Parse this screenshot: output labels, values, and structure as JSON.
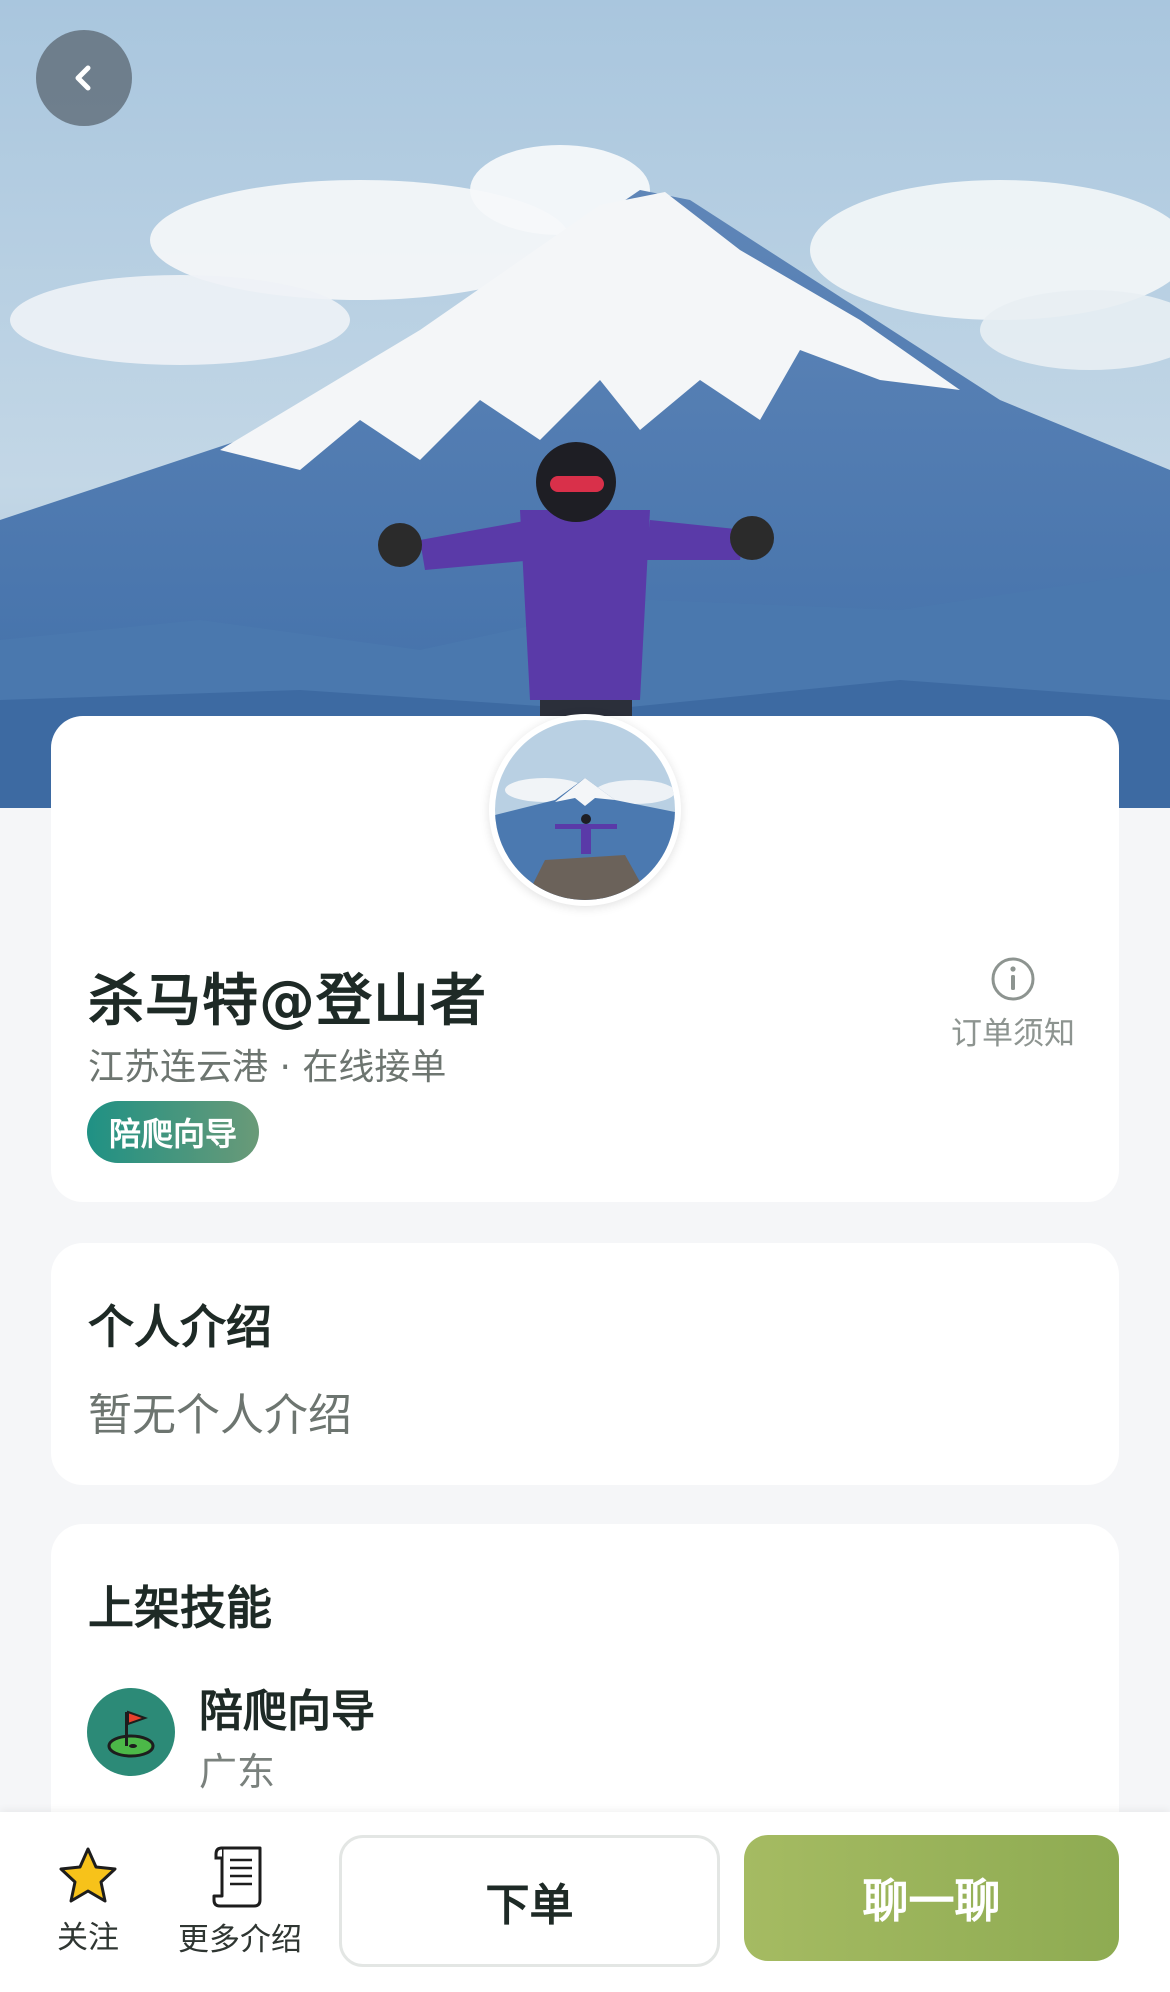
{
  "header": {
    "back_icon": "chevron-left-icon"
  },
  "profile": {
    "name": "杀马特@登山者",
    "location": "江苏连云港 · 在线接单",
    "tag": "陪爬向导",
    "notice_label": "订单须知",
    "notice_icon": "info-icon"
  },
  "intro": {
    "title": "个人介绍",
    "text": "暂无个人介绍"
  },
  "skills": {
    "title": "上架技能",
    "items": [
      {
        "name": "陪爬向导",
        "region": "广东",
        "icon": "golf-flag-icon"
      }
    ]
  },
  "bottom_bar": {
    "follow_label": "关注",
    "follow_icon": "star-icon",
    "more_label": "更多介绍",
    "more_icon": "scroll-icon",
    "order_label": "下单",
    "chat_label": "聊一聊"
  },
  "colors": {
    "accent_green": "#9bb45c",
    "tag_teal": "#1f9184",
    "page_bg": "#f5f6f8"
  }
}
